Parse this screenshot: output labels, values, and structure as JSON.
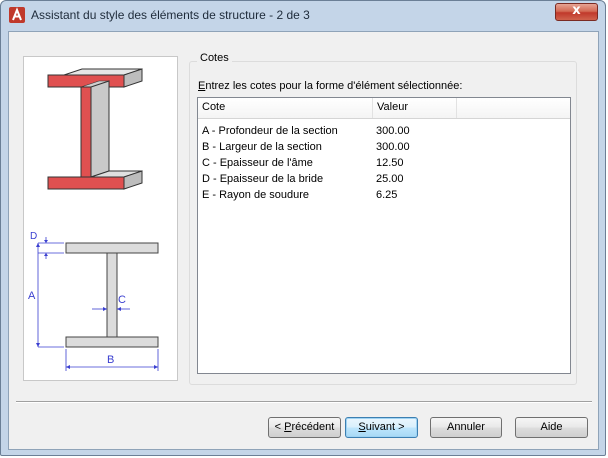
{
  "window": {
    "title": "Assistant du style des éléments de structure - 2 de 3",
    "close_glyph": "x"
  },
  "preview": {
    "dimension_labels": {
      "d": "D",
      "a": "A",
      "c": "C",
      "b": "B"
    },
    "accent_color": "#e05050"
  },
  "group": {
    "title": "Cotes",
    "instruction": "Entrez les cotes pour la forme d'élément sélectionnée:"
  },
  "table": {
    "columns": [
      "Cote",
      "Valeur"
    ],
    "rows": [
      {
        "cote": "A - Profondeur de la section",
        "valeur": "300.00"
      },
      {
        "cote": "B - Largeur de la section",
        "valeur": "300.00"
      },
      {
        "cote": "C - Epaisseur de l'âme",
        "valeur": "12.50"
      },
      {
        "cote": "D - Epaisseur de la bride",
        "valeur": "25.00"
      },
      {
        "cote": "E - Rayon de soudure",
        "valeur": "6.25"
      }
    ]
  },
  "buttons": {
    "previous": {
      "prefix": "< ",
      "mnemonic": "P",
      "rest": "récédent"
    },
    "next": {
      "mnemonic": "S",
      "rest": "uivant >"
    },
    "cancel": "Annuler",
    "help": "Aide"
  }
}
